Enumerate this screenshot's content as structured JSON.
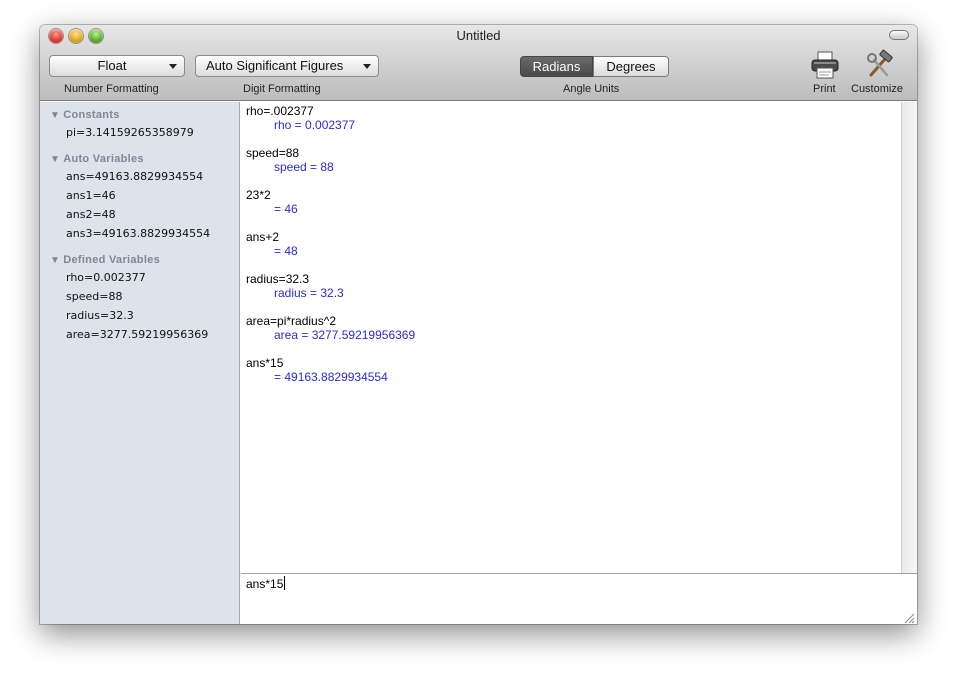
{
  "window": {
    "title": "Untitled"
  },
  "toolbar": {
    "number_format": "Float",
    "digit_format": "Auto Significant Figures",
    "angle_radians": "Radians",
    "angle_degrees": "Degrees",
    "label_number": "Number Formatting",
    "label_digit": "Digit Formatting",
    "label_angle": "Angle Units",
    "label_print": "Print",
    "label_customize": "Customize"
  },
  "sidebar": {
    "constants": {
      "title": "Constants",
      "items": [
        "pi=3.14159265358979"
      ]
    },
    "auto_variables": {
      "title": "Auto Variables",
      "items": [
        "ans=49163.8829934554",
        "ans1=46",
        "ans2=48",
        "ans3=49163.8829934554"
      ]
    },
    "defined_variables": {
      "title": "Defined Variables",
      "items": [
        "rho=0.002377",
        "speed=88",
        "radius=32.3",
        "area=3277.59219956369"
      ]
    }
  },
  "history": [
    {
      "input": "rho=.002377",
      "output": "rho = 0.002377"
    },
    {
      "input": "speed=88",
      "output": "speed = 88"
    },
    {
      "input": "23*2",
      "output": "= 46"
    },
    {
      "input": "ans+2",
      "output": "= 48"
    },
    {
      "input": "radius=32.3",
      "output": "radius = 32.3"
    },
    {
      "input": "area=pi*radius^2",
      "output": "area = 3277.59219956369"
    },
    {
      "input": "ans*15",
      "output": "= 49163.8829934554"
    }
  ],
  "input": {
    "value": "ans*15"
  },
  "colors": {
    "result": "#2b2bd6",
    "sidebar_bg": "#dde3ea",
    "section_header": "#7b8898"
  }
}
